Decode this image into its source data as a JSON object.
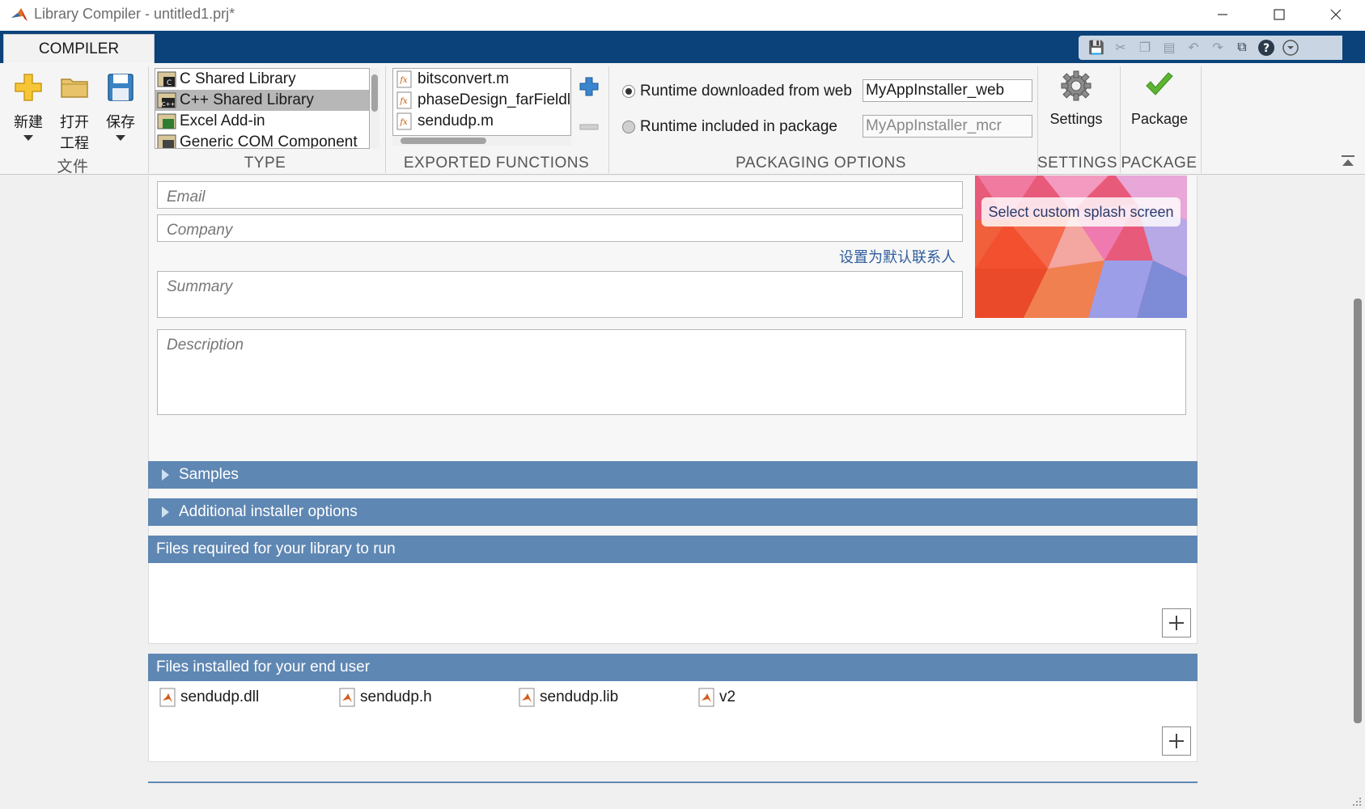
{
  "window": {
    "title": "Library Compiler - untitled1.prj*"
  },
  "ribbon": {
    "tab_label": "COMPILER",
    "file_group": {
      "label": "文件",
      "new_label": "新建",
      "open_label_line1": "打开",
      "open_label_line2": "工程",
      "save_label": "保存"
    },
    "type_group": {
      "label": "TYPE",
      "items": [
        "C Shared Library",
        "C++ Shared Library",
        "Excel Add-in",
        "Generic COM Component"
      ],
      "selected": "C++ Shared Library"
    },
    "exported_group": {
      "label": "EXPORTED FUNCTIONS",
      "files": [
        "bitsconvert.m",
        "phaseDesign_farFieldl",
        "sendudp.m"
      ]
    },
    "packaging_group": {
      "label": "PACKAGING OPTIONS",
      "option_web_label": "Runtime downloaded from web",
      "option_web_value": "MyAppInstaller_web",
      "option_pkg_label": "Runtime included in package",
      "option_pkg_value": "MyAppInstaller_mcr",
      "selected": "web"
    },
    "settings_group": {
      "label": "SETTINGS",
      "button_label": "Settings"
    },
    "package_group": {
      "label": "PACKAGE",
      "button_label": "Package"
    }
  },
  "form": {
    "email_placeholder": "Email",
    "company_placeholder": "Company",
    "set_default_contact_link": "设置为默认联系人",
    "summary_placeholder": "Summary",
    "description_placeholder": "Description",
    "splash_button": "Select custom splash screen"
  },
  "sections": {
    "samples": "Samples",
    "additional_installer_options": "Additional installer options",
    "files_required": "Files required for your library to run",
    "files_installed": "Files installed for your end user"
  },
  "installed_files": [
    "sendudp.dll",
    "sendudp.h",
    "sendudp.lib",
    "v2"
  ],
  "colors": {
    "ribbon_bar": "#0b427a",
    "section_header": "#5f87b3",
    "link": "#2f5d9c"
  }
}
